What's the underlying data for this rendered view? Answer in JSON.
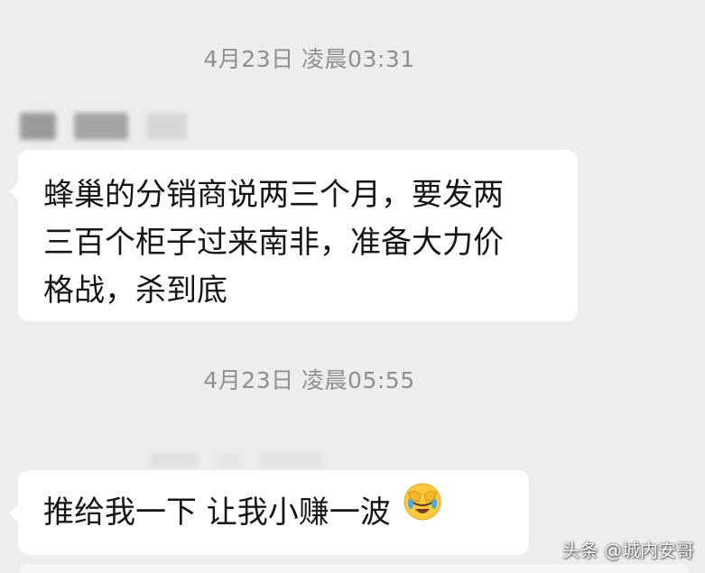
{
  "chat": {
    "timestamps": [
      "4月23日 凌晨03:31",
      "4月23日 凌晨05:55"
    ],
    "messages": [
      {
        "lines": [
          "蜂巢的分销商说两三个月，要发两",
          "三百个柜子过来南非，准备大力价",
          "格战，杀到底"
        ]
      },
      {
        "text": "推给我一下  让我小赚一波",
        "emoji": "facepalm-laugh-emoji"
      }
    ]
  },
  "watermark": {
    "text": "头条 @城内安哥"
  },
  "colors": {
    "background": "#ededed",
    "bubble": "#ffffff",
    "timestamp": "#8f8f8f",
    "text": "#161616"
  }
}
